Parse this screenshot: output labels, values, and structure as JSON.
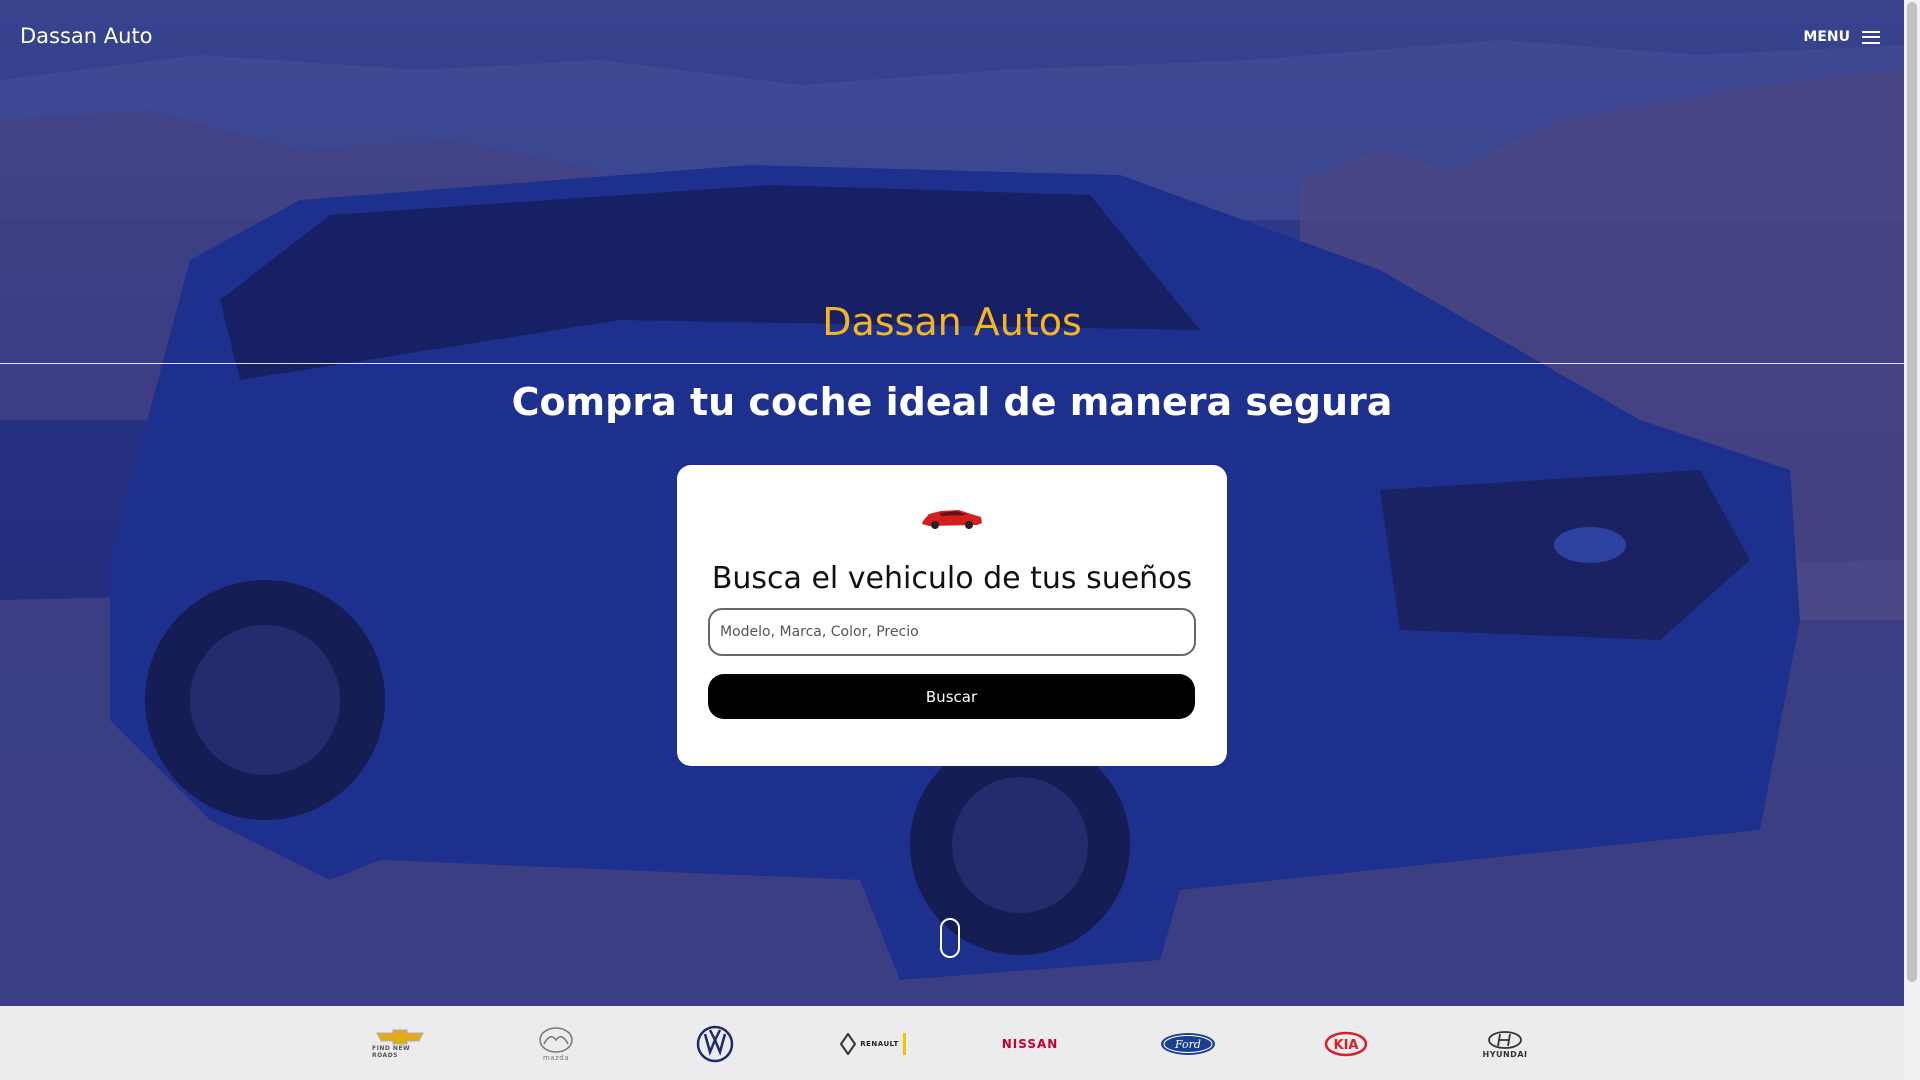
{
  "header": {
    "brand": "Dassan Auto",
    "menu_label": "MENU"
  },
  "hero": {
    "title": "Dassan Autos",
    "subtitle": "Compra tu coche ideal de manera segura"
  },
  "search": {
    "title": "Busca el vehiculo de tus sueños",
    "placeholder": "Modelo, Marca, Color, Precio",
    "value": "",
    "button_label": "Buscar"
  },
  "brands": [
    {
      "name": "chevrolet",
      "caption": "FIND NEW ROADS"
    },
    {
      "name": "mazda",
      "caption": "mazda"
    },
    {
      "name": "volkswagen",
      "caption": ""
    },
    {
      "name": "renault",
      "caption": "RENAULT"
    },
    {
      "name": "nissan",
      "caption": "NISSAN"
    },
    {
      "name": "ford",
      "caption": "Ford"
    },
    {
      "name": "kia",
      "caption": "KIA"
    },
    {
      "name": "hyundai",
      "caption": "HYUNDAI"
    }
  ],
  "colors": {
    "accent": "#f5b520",
    "hero_tint": "#2d3a86",
    "button": "#000000",
    "kia_red": "#d6202a",
    "ford_blue": "#1b3f8f"
  }
}
